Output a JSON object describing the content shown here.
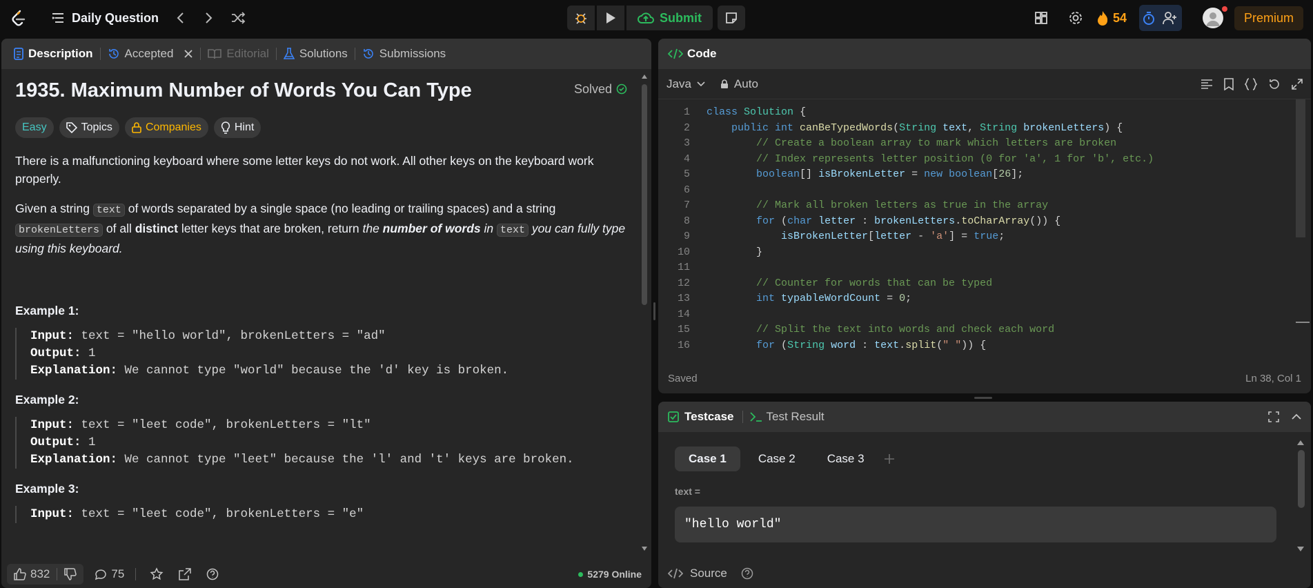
{
  "topbar": {
    "title": "Daily Question",
    "submit_label": "Submit",
    "streak_count": "54",
    "premium_label": "Premium"
  },
  "left_tabs": [
    {
      "label": "Description"
    },
    {
      "label": "Accepted"
    },
    {
      "label": "Editorial"
    },
    {
      "label": "Solutions"
    },
    {
      "label": "Submissions"
    }
  ],
  "problem": {
    "title": "1935. Maximum Number of Words You Can Type",
    "status": "Solved",
    "tags": [
      "Easy",
      "Topics",
      "Companies",
      "Hint"
    ],
    "para1": "There is a malfunctioning keyboard where some letter keys do not work. All other keys on the keyboard work properly.",
    "para2_a": "Given a string ",
    "para2_code1": "text",
    "para2_b": " of words separated by a single space (no leading or trailing spaces) and a string ",
    "para2_code2": "brokenLetters",
    "para2_c": " of all ",
    "para2_bold": "distinct",
    "para2_d": " letter keys that are broken, return ",
    "para2_e": "the ",
    "para2_f": "number of words",
    "para2_g": " in ",
    "para2_code3": "text",
    "para2_h": " you can fully type using this keyboard.",
    "examples": [
      {
        "heading": "Example 1:",
        "input_label": "Input:",
        "input": " text = \"hello world\", brokenLetters = \"ad\"",
        "output_label": "Output:",
        "output": " 1",
        "expl_label": "Explanation:",
        "expl": " We cannot type \"world\" because the 'd' key is broken."
      },
      {
        "heading": "Example 2:",
        "input_label": "Input:",
        "input": " text = \"leet code\", brokenLetters = \"lt\"",
        "output_label": "Output:",
        "output": " 1",
        "expl_label": "Explanation:",
        "expl": " We cannot type \"leet\" because the 'l' and 't' keys are broken."
      },
      {
        "heading": "Example 3:",
        "input_label": "Input:",
        "input": " text = \"leet code\", brokenLetters = \"e\""
      }
    ]
  },
  "left_footer": {
    "likes": "832",
    "comments": "75",
    "online": "5279 Online"
  },
  "code_panel": {
    "title": "Code",
    "language": "Java",
    "mode": "Auto",
    "status": "Saved",
    "cursor": "Ln 38, Col 1",
    "line_numbers": [
      "1",
      "2",
      "3",
      "4",
      "5",
      "6",
      "7",
      "8",
      "9",
      "10",
      "11",
      "12",
      "13",
      "14",
      "15",
      "16"
    ]
  },
  "testcase_panel": {
    "tab_testcase": "Testcase",
    "tab_result": "Test Result",
    "cases": [
      "Case 1",
      "Case 2",
      "Case 3"
    ],
    "param_label": "text =",
    "param_value": "\"hello world\"",
    "source_label": "Source"
  },
  "colors": {
    "accent": "#ffa116",
    "green": "#2cbb5d",
    "easy": "#46c6c2",
    "blue": "#3b82f6"
  }
}
